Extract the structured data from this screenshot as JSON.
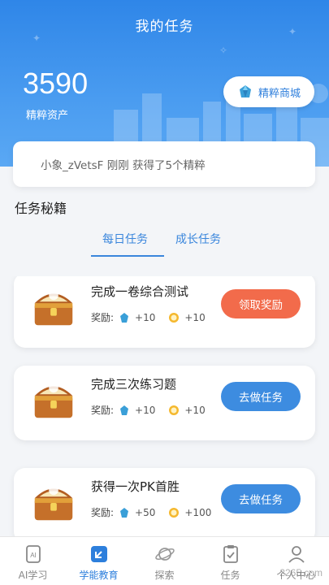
{
  "header": {
    "title": "我的任务"
  },
  "assets": {
    "value": "3590",
    "label": "精粹资产"
  },
  "mall_button": {
    "label": "精粹商城",
    "icon": "gem-icon"
  },
  "notice": {
    "text": "小象_zVetsF 刚刚 获得了5个精粹"
  },
  "section": {
    "title": "任务秘籍"
  },
  "tabs": [
    {
      "label": "每日任务",
      "active": true
    },
    {
      "label": "成长任务",
      "active": false
    }
  ],
  "tasks": [
    {
      "title": "完成一卷综合测试",
      "reward_label": "奖励:",
      "gem_reward": "+10",
      "coin_reward": "+10",
      "action": "领取奖励",
      "action_type": "claim"
    },
    {
      "title": "完成三次练习题",
      "reward_label": "奖励:",
      "gem_reward": "+10",
      "coin_reward": "+10",
      "action": "去做任务",
      "action_type": "todo"
    },
    {
      "title": "获得一次PK首胜",
      "reward_label": "奖励:",
      "gem_reward": "+50",
      "coin_reward": "+100",
      "action": "去做任务",
      "action_type": "todo"
    }
  ],
  "bottom_nav": [
    {
      "label": "AI学习",
      "icon": "ai-study-icon",
      "active": false
    },
    {
      "label": "学能教育",
      "icon": "education-icon",
      "active": true
    },
    {
      "label": "探索",
      "icon": "planet-icon",
      "active": false
    },
    {
      "label": "任务",
      "icon": "task-icon",
      "active": false
    },
    {
      "label": "个人中心",
      "icon": "profile-icon",
      "active": false
    }
  ],
  "watermark": "2265.com",
  "colors": {
    "primary": "#3a86dc",
    "claim": "#f26b4b",
    "hero_top": "#2f86e8"
  }
}
